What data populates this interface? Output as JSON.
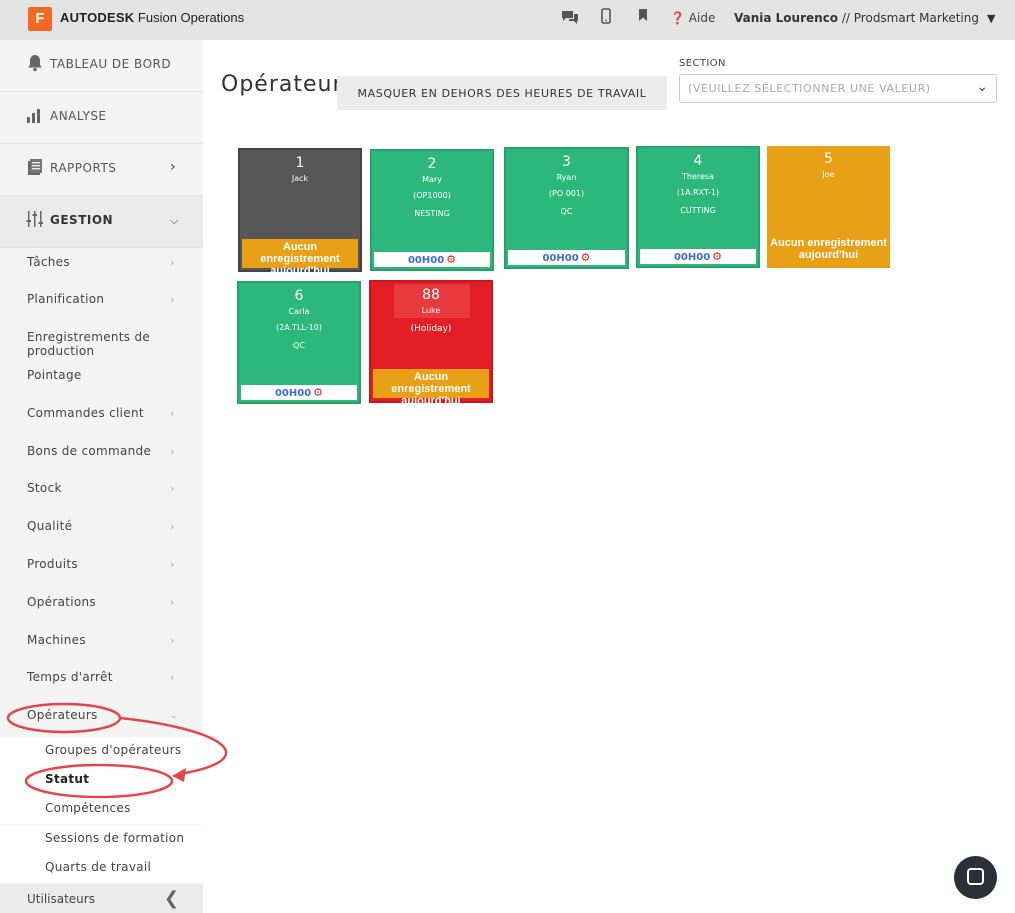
{
  "topbar": {
    "logo_letter": "F",
    "brand_bold": "AUTODESK",
    "brand_rest": " Fusion Operations",
    "help_label": "Aide",
    "user_name": "Vania Lourenco",
    "user_org": " // Prodsmart Marketing",
    "icons": [
      "chat-icon",
      "mobile-icon",
      "bookmark-icon",
      "help-icon"
    ]
  },
  "sidebar": {
    "main": [
      {
        "label": "TABLEAU DE BORD",
        "icon": "bell-icon"
      },
      {
        "label": "ANALYSE",
        "icon": "bar-chart-icon"
      },
      {
        "label": "RAPPORTS",
        "icon": "report-icon"
      },
      {
        "label": "GESTION",
        "icon": "sliders-icon"
      }
    ],
    "items": [
      {
        "label": "Tâches"
      },
      {
        "label": "Planification"
      },
      {
        "label": "Enregistrements de production"
      },
      {
        "label": "Pointage"
      },
      {
        "label": "Commandes client"
      },
      {
        "label": "Bons de commande"
      },
      {
        "label": "Stock"
      },
      {
        "label": "Qualité"
      },
      {
        "label": "Produits"
      },
      {
        "label": "Opérations"
      },
      {
        "label": "Machines"
      },
      {
        "label": "Temps d'arrêt"
      },
      {
        "label": "Opérateurs"
      }
    ],
    "sub_items": [
      {
        "label": "Groupes d'opérateurs"
      },
      {
        "label": "Statut"
      },
      {
        "label": "Compétences"
      },
      {
        "label": "Sessions de formation"
      },
      {
        "label": "Quarts de travail"
      }
    ],
    "bottom": {
      "label": "Utilisateurs"
    }
  },
  "main": {
    "title": "Opérateurs",
    "hide_button": "MASQUER EN DEHORS DES HEURES DE TRAVAIL",
    "section_label": "SECTION",
    "section_placeholder": "(VEUILLEZ SÉLECTIONNER UNE VALEUR)"
  },
  "operators": [
    {
      "num": "1",
      "name": "Jack",
      "code": "",
      "stage": "",
      "status": "Aucun enregistrement aujourd'hui",
      "time": "",
      "color": "#575757"
    },
    {
      "num": "2",
      "name": "Mary",
      "code": "(OP1000)",
      "stage": "NESTING",
      "status": "",
      "time": "00H00",
      "color": "#2cb87a"
    },
    {
      "num": "3",
      "name": "Ryan",
      "code": "(PO 001)",
      "stage": "QC",
      "status": "",
      "time": "00H00",
      "color": "#2cb87a"
    },
    {
      "num": "4",
      "name": "Theresa",
      "code": "(1A.RXT-1)",
      "stage": "CUTTING",
      "status": "",
      "time": "00H00",
      "color": "#2cb87a"
    },
    {
      "num": "5",
      "name": "Joe",
      "code": "",
      "stage": "",
      "status": "Aucun enregistrement aujourd'hui",
      "time": "",
      "color": "#e8a117"
    },
    {
      "num": "6",
      "name": "Carla",
      "code": "(2A.TLL-10)",
      "stage": "QC",
      "status": "",
      "time": "00H00",
      "color": "#2cb87a"
    },
    {
      "num": "88",
      "name": "Luke",
      "code": "(Holiday)",
      "stage": "",
      "status": "Aucun enregistrement aujourd'hui",
      "time": "",
      "color": "#e31e24"
    }
  ],
  "colors": {
    "annotation": "#e5464b",
    "green": "#2cb87a",
    "orange": "#e8a117",
    "red": "#e31e24",
    "grey": "#575757"
  }
}
